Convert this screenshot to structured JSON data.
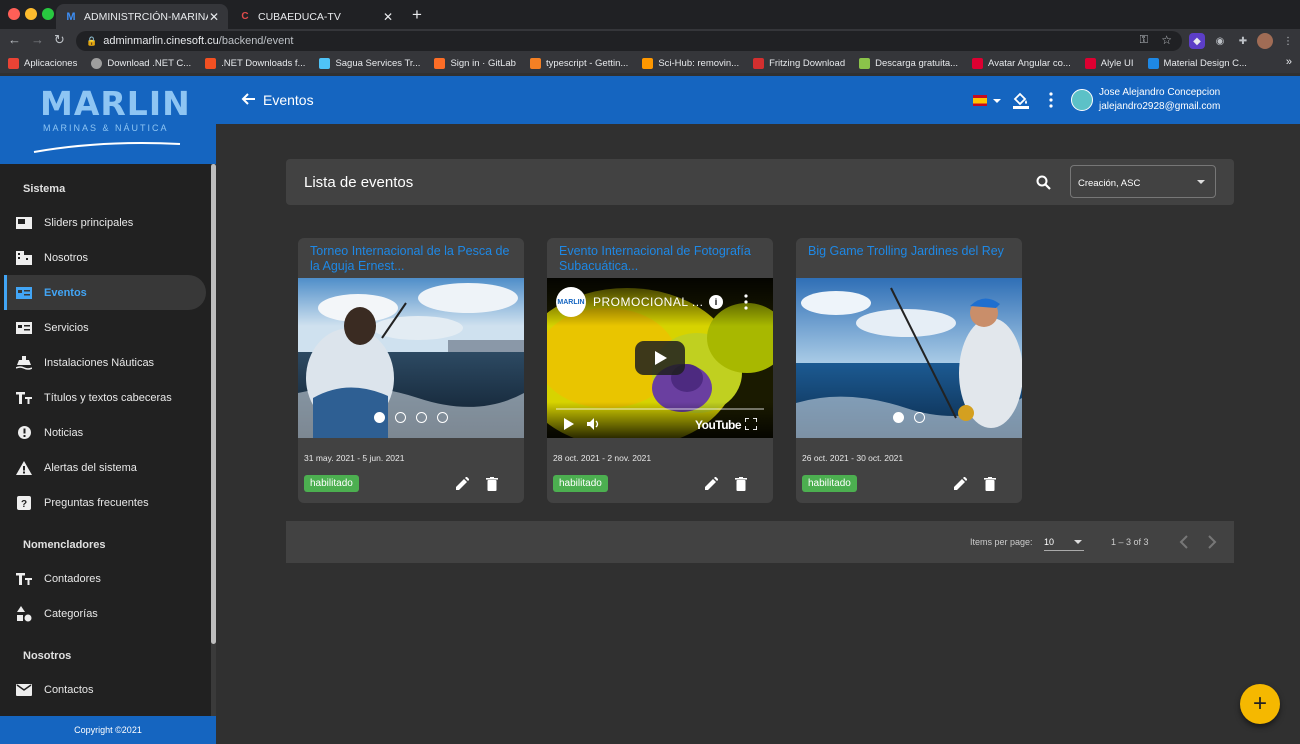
{
  "browser": {
    "tabs": [
      {
        "title": "ADMINISTRCIÓN-MARINAS-M",
        "favicon": "M",
        "active": true
      },
      {
        "title": "CUBAEDUCA-TV",
        "favicon": "C",
        "active": false
      }
    ],
    "url_host": "adminmarlin.cinesoft.cu",
    "url_path": "/backend/event",
    "bookmarks": [
      {
        "label": "Aplicaciones",
        "color": "#ea4335"
      },
      {
        "label": "Download .NET C...",
        "color": "#9e9e9e"
      },
      {
        "label": ".NET Downloads f...",
        "color": "#f25022"
      },
      {
        "label": "Sagua Services Tr...",
        "color": "#4fc3f7"
      },
      {
        "label": "Sign in · GitLab",
        "color": "#fc6d26"
      },
      {
        "label": "typescript - Gettin...",
        "color": "#f48024"
      },
      {
        "label": "Sci-Hub: removin...",
        "color": "#ff9800"
      },
      {
        "label": "Fritzing Download",
        "color": "#d32f2f"
      },
      {
        "label": "Descarga gratuita...",
        "color": "#8bc34a"
      },
      {
        "label": "Avatar Angular co...",
        "color": "#dd0031"
      },
      {
        "label": "Alyle UI",
        "color": "#dd0031"
      },
      {
        "label": "Material Design C...",
        "color": "#1e88e5"
      }
    ]
  },
  "brand": {
    "name": "MARLIN",
    "tagline": "MARINAS & NÁUTICA"
  },
  "sidebar": {
    "sections": [
      {
        "title": "Sistema",
        "items": [
          {
            "label": "Sliders principales",
            "icon": "slider-icon"
          },
          {
            "label": "Nosotros",
            "icon": "building-icon"
          },
          {
            "label": "Eventos",
            "icon": "event-icon",
            "active": true
          },
          {
            "label": "Servicios",
            "icon": "service-icon"
          },
          {
            "label": "Instalaciones Náuticas",
            "icon": "boat-icon"
          },
          {
            "label": "Títulos y textos cabeceras",
            "icon": "text-icon"
          },
          {
            "label": "Noticias",
            "icon": "news-icon"
          },
          {
            "label": "Alertas del sistema",
            "icon": "warning-icon"
          },
          {
            "label": "Preguntas frecuentes",
            "icon": "help-icon"
          }
        ]
      },
      {
        "title": "Nomencladores",
        "items": [
          {
            "label": "Contadores",
            "icon": "text-icon"
          },
          {
            "label": "Categorías",
            "icon": "category-icon"
          }
        ]
      },
      {
        "title": "Nosotros",
        "items": [
          {
            "label": "Contactos",
            "icon": "mail-icon"
          }
        ]
      }
    ],
    "copyright": "Copyright ©2021"
  },
  "topbar": {
    "title": "Eventos",
    "user_name": "Jose Alejandro Concepcion",
    "user_email": "jalejandro2928@gmail.com"
  },
  "list": {
    "title": "Lista de eventos",
    "sort_value": "Creación, ASC"
  },
  "events": [
    {
      "title": "Torneo Internacional de la Pesca de la Aguja Ernest...",
      "date": "31 may. 2021 - 5 jun. 2021",
      "status": "habilitado",
      "media": "photo",
      "dots": 4,
      "active_dot": 0
    },
    {
      "title": "Evento Internacional de Fotografía Subacuática...",
      "date": "28 oct. 2021 - 2 nov. 2021",
      "status": "habilitado",
      "media": "video",
      "video_title": "PROMOCIONAL ...",
      "video_channel": "MARLIN",
      "video_brand": "YouTube"
    },
    {
      "title": "Big Game Trolling Jardines del Rey",
      "date": "26 oct. 2021 - 30 oct. 2021",
      "status": "habilitado",
      "media": "photo",
      "dots": 2,
      "active_dot": 0
    }
  ],
  "paginator": {
    "items_per_page_label": "Items per page:",
    "items_per_page": "10",
    "range": "1 – 3 of 3"
  },
  "colors": {
    "primary": "#1565c0",
    "accent": "#f5b800",
    "status_enabled": "#4caf50",
    "link": "#1e88e5"
  }
}
